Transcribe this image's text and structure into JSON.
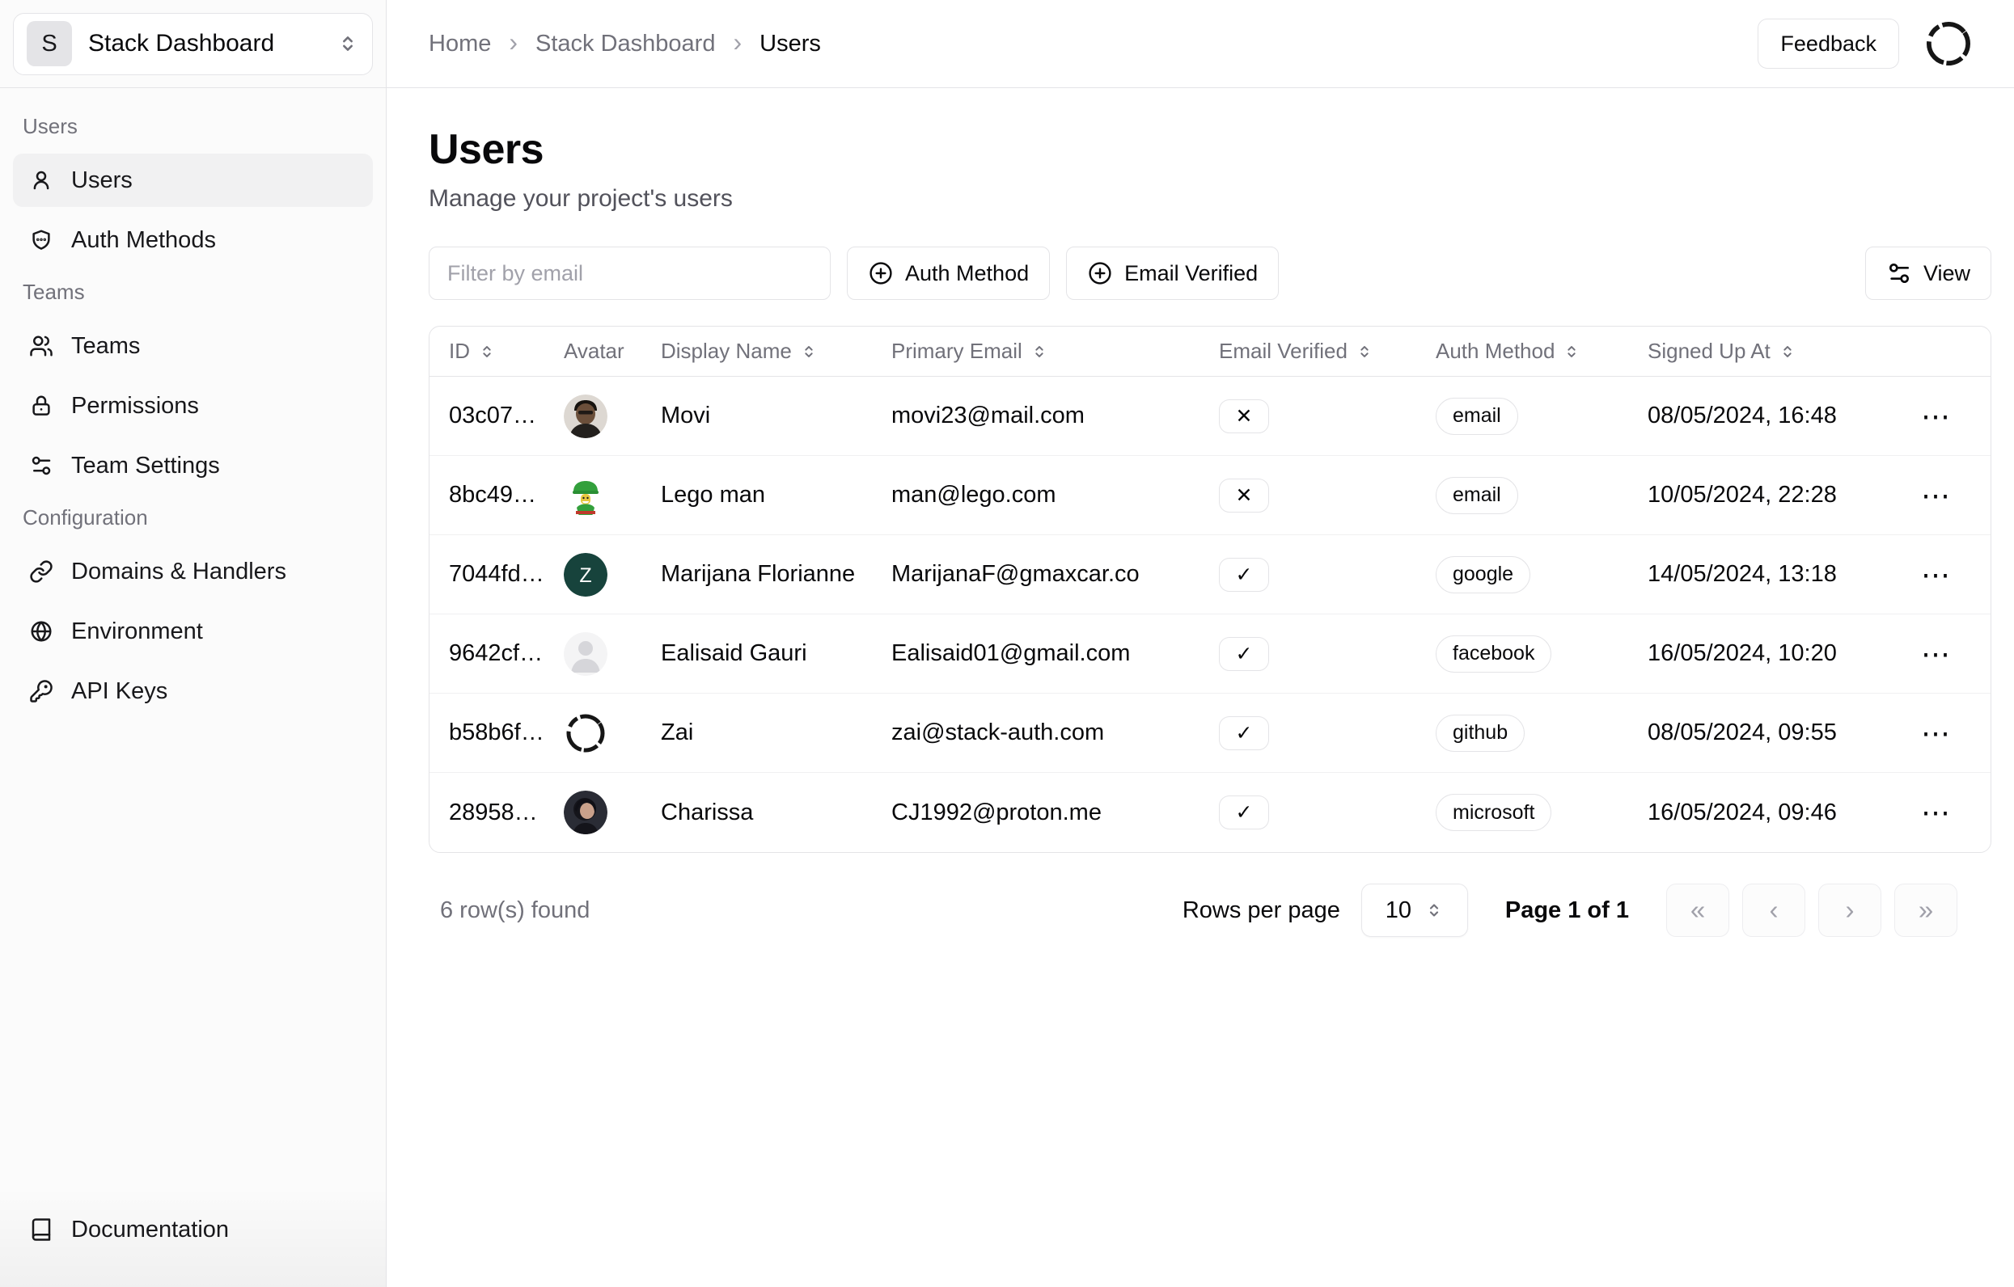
{
  "app": {
    "project_name": "Stack Dashboard",
    "project_initial": "S"
  },
  "sidebar": {
    "sections": [
      {
        "label": "Users",
        "items": [
          {
            "label": "Users",
            "icon": "user",
            "active": true
          },
          {
            "label": "Auth Methods",
            "icon": "shield",
            "active": false
          }
        ]
      },
      {
        "label": "Teams",
        "items": [
          {
            "label": "Teams",
            "icon": "users",
            "active": false
          },
          {
            "label": "Permissions",
            "icon": "lock",
            "active": false
          },
          {
            "label": "Team Settings",
            "icon": "settings-sliders",
            "active": false
          }
        ]
      },
      {
        "label": "Configuration",
        "items": [
          {
            "label": "Domains & Handlers",
            "icon": "link",
            "active": false
          },
          {
            "label": "Environment",
            "icon": "globe",
            "active": false
          },
          {
            "label": "API Keys",
            "icon": "key",
            "active": false
          }
        ]
      }
    ],
    "footer_item": {
      "label": "Documentation",
      "icon": "book"
    }
  },
  "header": {
    "breadcrumb": [
      "Home",
      "Stack Dashboard",
      "Users"
    ],
    "feedback_label": "Feedback"
  },
  "page": {
    "title": "Users",
    "subtitle": "Manage your project's users"
  },
  "toolbar": {
    "filter_placeholder": "Filter by email",
    "auth_method_label": "Auth Method",
    "email_verified_label": "Email Verified",
    "view_label": "View"
  },
  "table": {
    "columns": [
      {
        "label": "ID",
        "sortable": true
      },
      {
        "label": "Avatar",
        "sortable": false
      },
      {
        "label": "Display Name",
        "sortable": true
      },
      {
        "label": "Primary Email",
        "sortable": true
      },
      {
        "label": "Email Verified",
        "sortable": true
      },
      {
        "label": "Auth Method",
        "sortable": true
      },
      {
        "label": "Signed Up At",
        "sortable": true
      }
    ],
    "rows": [
      {
        "id": "03c07…",
        "display_name": "Movi",
        "primary_email": "movi23@mail.com",
        "email_verified": false,
        "auth_method": "email",
        "signed_up_at": "08/05/2024, 16:48"
      },
      {
        "id": "8bc49…",
        "display_name": "Lego man",
        "primary_email": "man@lego.com",
        "email_verified": false,
        "auth_method": "email",
        "signed_up_at": "10/05/2024, 22:28"
      },
      {
        "id": "7044fd…",
        "display_name": "Marijana Florianne",
        "primary_email": "MarijanaF@gmaxcar.co",
        "email_verified": true,
        "auth_method": "google",
        "signed_up_at": "14/05/2024, 13:18"
      },
      {
        "id": "9642cf…",
        "display_name": "Ealisaid Gauri",
        "primary_email": "Ealisaid01@gmail.com",
        "email_verified": true,
        "auth_method": "facebook",
        "signed_up_at": "16/05/2024, 10:20"
      },
      {
        "id": "b58b6f…",
        "display_name": "Zai",
        "primary_email": "zai@stack-auth.com",
        "email_verified": true,
        "auth_method": "github",
        "signed_up_at": "08/05/2024, 09:55"
      },
      {
        "id": "28958…",
        "display_name": "Charissa",
        "primary_email": "CJ1992@proton.me",
        "email_verified": true,
        "auth_method": "microsoft",
        "signed_up_at": "16/05/2024, 09:46"
      }
    ]
  },
  "footer": {
    "rows_found": "6 row(s) found",
    "rows_per_page_label": "Rows per page",
    "rows_per_page_value": "10",
    "page_info": "Page 1 of 1"
  },
  "icons": {
    "check": "✓",
    "cross": "✕",
    "ellipsis": "⋯",
    "breadcrumb_separator": "›",
    "pagination_first": "«",
    "pagination_prev": "‹",
    "pagination_next": "›",
    "pagination_last": "»"
  },
  "colors": {
    "sidebar_active_bg": "#f1f1f2",
    "avatar_letter_bg": "#17433c",
    "border": "#e4e4e7"
  }
}
